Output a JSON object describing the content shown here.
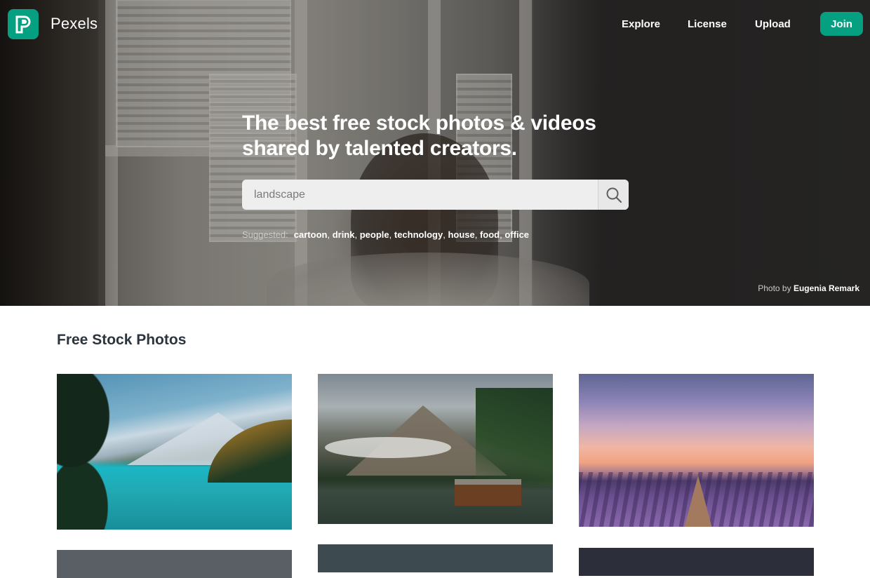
{
  "header": {
    "brand": "Pexels",
    "nav": [
      {
        "label": "Explore"
      },
      {
        "label": "License"
      },
      {
        "label": "Upload"
      }
    ],
    "join_label": "Join"
  },
  "hero": {
    "headline": "The best free stock photos & videos shared by talented creators.",
    "search": {
      "value": "",
      "placeholder": "landscape"
    },
    "suggested_label": "Suggested:",
    "suggested": [
      "cartoon",
      "drink",
      "people",
      "technology",
      "house",
      "food",
      "office"
    ],
    "credit_prefix": "Photo by",
    "credit_author": "Eugenia Remark"
  },
  "section": {
    "title": "Free Stock Photos"
  },
  "colors": {
    "brand": "#05a081",
    "heading": "#2c343e"
  },
  "icons": {
    "logo": "pexels-logo-icon",
    "search": "search-icon"
  }
}
